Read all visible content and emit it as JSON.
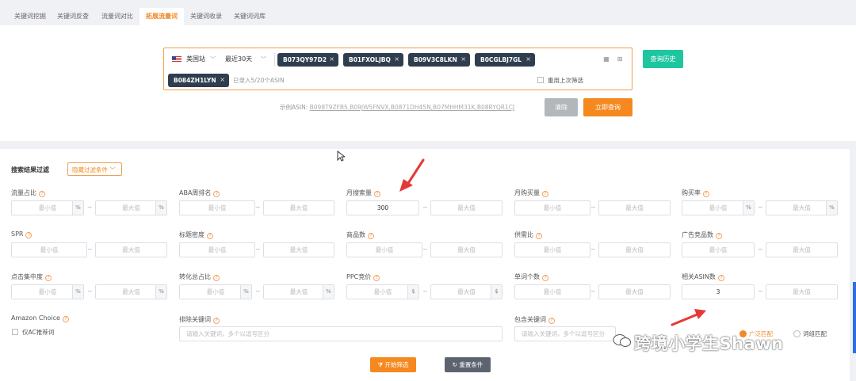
{
  "tabs": [
    "关键词挖掘",
    "关键词反查",
    "流量词对比",
    "拓展流量词",
    "关键词收录",
    "关键词词库"
  ],
  "active_tab_index": 3,
  "search": {
    "site": "美国站",
    "period": "最近30天",
    "asins": [
      "B073QY97D2",
      "B01FXOLJBQ",
      "B09V3C8LKN",
      "B0CGLBJ7GL",
      "B084ZH1LYN"
    ],
    "count_hint": "已录入5/20个ASIN",
    "reuse_label": "重用上次筛选",
    "history_button": "查询历史",
    "example_label": "示例ASIN:",
    "example_value": "B098T9ZFB5,B09JW5FNVX,B0871DH45N,B07MHHM31K,B08RYQR1CJ",
    "clear_button": "清除",
    "query_button": "立即查询"
  },
  "filter": {
    "title": "搜索结果过滤",
    "hide_button": "隐藏过滤条件",
    "min_placeholder": "最小值",
    "max_placeholder": "最大值",
    "range_sep": "~",
    "fields": {
      "traffic_share": "流量占比",
      "aba_rank": "ABA周排名",
      "monthly_search": "月搜索量",
      "monthly_purchase": "月购买量",
      "purchase_rate": "购买率",
      "spr": "SPR",
      "title_density": "标题密度",
      "product_count": "商品数",
      "supply_demand": "供需比",
      "ad_product_count": "广告竞品数",
      "click_concentration": "点击集中度",
      "conversion_share": "转化总占比",
      "ppc_bid": "PPC竞价",
      "word_count": "单词个数",
      "related_asin_count": "相关ASIN数",
      "amazon_choice": "Amazon Choice",
      "exclude_keywords": "排除关键词",
      "include_keywords": "包含关键词"
    },
    "monthly_search_min": "300",
    "related_asin_min": "3",
    "ac_only_label": "仅AC推荐词",
    "keyword_placeholder": "请输入关键词，多个以逗号区分",
    "match_broad": "广泛匹配",
    "match_phrase": "词组匹配",
    "start_button": "开始筛选",
    "reset_button": "重置条件",
    "unit_percent": "%",
    "unit_dollar": "$"
  },
  "watermark": "跨境小学生Shawn",
  "colors": {
    "accent": "#f08a24",
    "history_button": "#1ec6a0",
    "tag_bg": "#2f3e4f",
    "arrow": "#e53935"
  }
}
